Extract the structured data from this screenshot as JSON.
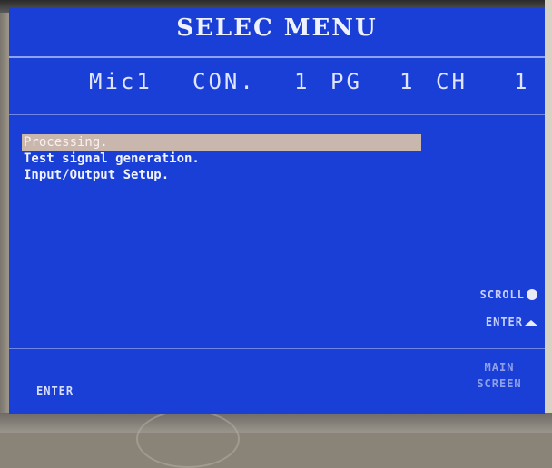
{
  "screen": {
    "title": "SELEC MENU",
    "status": {
      "source": "Mic1",
      "con_label": "CON.",
      "con_value": "1",
      "pg_label": "PG",
      "pg_value": "1",
      "ch_label": "CH",
      "ch_value": "1"
    },
    "menu": {
      "items": [
        {
          "label": "Processing.",
          "selected": true
        },
        {
          "label": "Test signal generation.",
          "selected": false
        },
        {
          "label": "Input/Output Setup.",
          "selected": false
        }
      ]
    },
    "hints": {
      "scroll_label": "SCROLL",
      "scroll_icon": "knob-icon",
      "enter_label": "ENTER",
      "enter_icon": "enter-triangle-icon"
    },
    "softkeys": {
      "left_label": "ENTER",
      "right_line1": "MAIN",
      "right_line2": "SCREEN"
    },
    "colors": {
      "background": "#1a3fd6",
      "text": "#e8ecff",
      "selection": "#c9b7ae"
    }
  }
}
